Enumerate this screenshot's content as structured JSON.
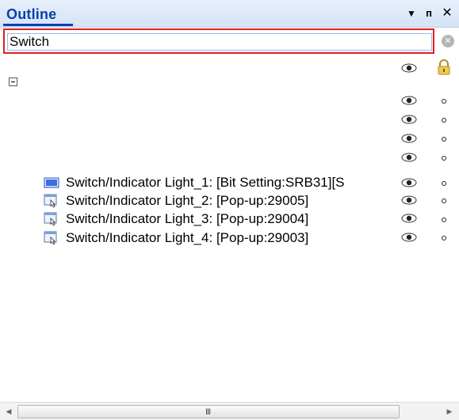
{
  "panel": {
    "title": "Outline",
    "dropdown_glyph": "▼",
    "pin_glyph": "ᴨ",
    "close_glyph": "✕"
  },
  "search": {
    "value": "Switch",
    "clear_glyph": "✕"
  },
  "tree": {
    "items": [
      {
        "label": "Switch/Indicator Light_1: [Bit Setting:SRB31][S",
        "icon": "bit-setting-icon"
      },
      {
        "label": "Switch/Indicator Light_2: [Pop-up:29005]",
        "icon": "popup-icon"
      },
      {
        "label": "Switch/Indicator Light_3: [Pop-up:29004]",
        "icon": "popup-icon"
      },
      {
        "label": "Switch/Indicator Light_4: [Pop-up:29003]",
        "icon": "popup-icon"
      }
    ]
  },
  "scrollbar": {
    "left_glyph": "◀",
    "right_glyph": "▶",
    "grip": "III"
  },
  "colors": {
    "title": "#0b3fb0",
    "highlight_border": "#e02020"
  }
}
